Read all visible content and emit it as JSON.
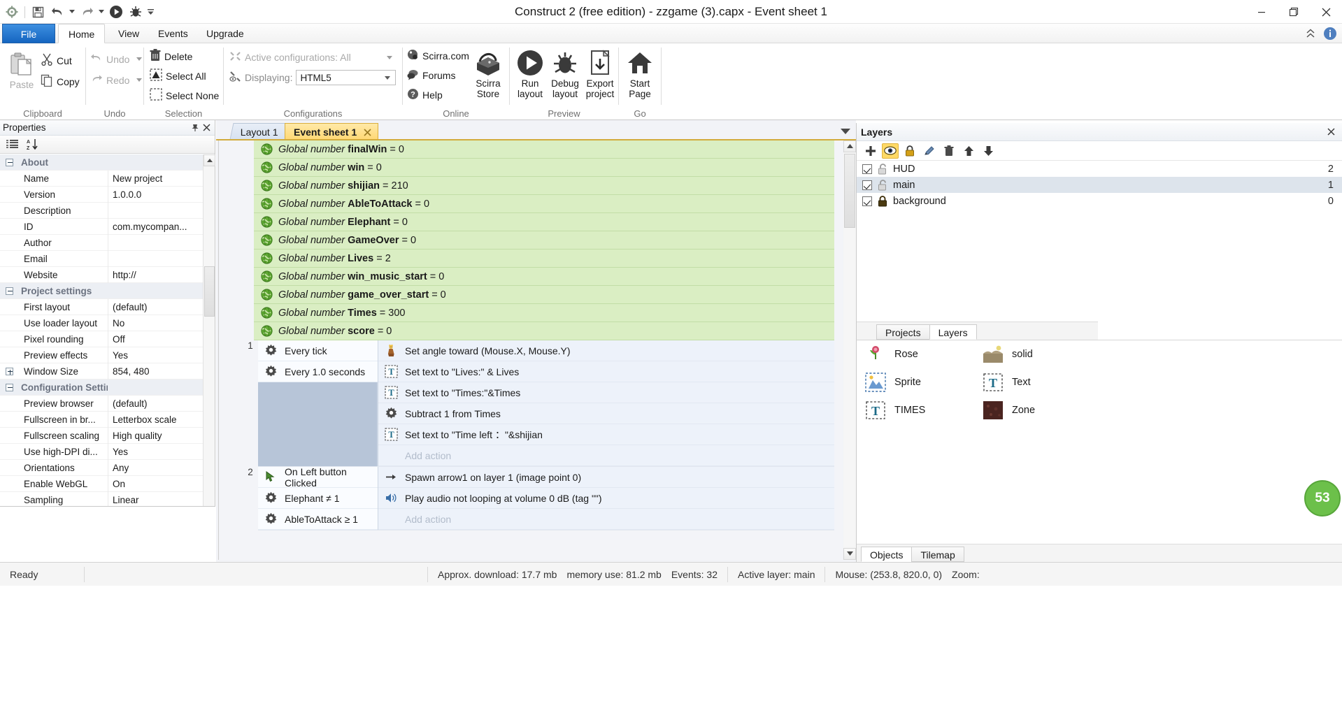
{
  "window": {
    "title": "Construct 2  (free edition) - zzgame (3).capx - Event sheet 1",
    "minimize_label": "Minimize",
    "maximize_label": "Restore",
    "close_label": "Close"
  },
  "quick_access": {
    "items": [
      {
        "name": "construct-logo-icon",
        "label": "Construct 2"
      },
      {
        "name": "save-icon",
        "label": "Save"
      },
      {
        "name": "undo-icon",
        "label": "Undo"
      },
      {
        "name": "undo-dropdown-icon",
        "label": "Undo history"
      },
      {
        "name": "redo-icon",
        "label": "Redo"
      },
      {
        "name": "redo-dropdown-icon",
        "label": "Redo history"
      },
      {
        "name": "run-icon",
        "label": "Run layout"
      },
      {
        "name": "debug-icon",
        "label": "Debug layout"
      },
      {
        "name": "customize-qat-icon",
        "label": "Customize Quick Access Toolbar"
      }
    ]
  },
  "ribbon": {
    "tabs": [
      {
        "label": "File",
        "active": false
      },
      {
        "label": "Home",
        "active": true
      },
      {
        "label": "View",
        "active": false
      },
      {
        "label": "Events",
        "active": false
      },
      {
        "label": "Upgrade",
        "active": false
      }
    ],
    "right_icons": [
      {
        "name": "ribbon-collapse-icon",
        "label": "Minimize the Ribbon"
      },
      {
        "name": "help-info-icon",
        "label": "Help"
      }
    ],
    "groups": [
      {
        "name": "clipboard",
        "label": "Clipboard",
        "items": [
          {
            "label": "Paste",
            "icon": "paste-icon",
            "disabled": true
          },
          {
            "label": "Cut",
            "icon": "cut-icon",
            "disabled": false
          },
          {
            "label": "Copy",
            "icon": "copy-icon",
            "disabled": false
          }
        ]
      },
      {
        "name": "undo",
        "label": "Undo",
        "items": [
          {
            "label": "Undo",
            "icon": "undo-icon",
            "disabled": true
          },
          {
            "label": "Redo",
            "icon": "redo-icon",
            "disabled": true
          }
        ]
      },
      {
        "name": "selection",
        "label": "Selection",
        "items": [
          {
            "label": "Delete",
            "icon": "delete-icon",
            "disabled": false
          },
          {
            "label": "Select All",
            "icon": "select-all-icon",
            "disabled": false
          },
          {
            "label": "Select None",
            "icon": "select-none-icon",
            "disabled": false
          }
        ]
      },
      {
        "name": "configurations",
        "label": "Configurations",
        "active_configurations_label": "Active configurations: All",
        "displaying_label": "Displaying:",
        "displaying_value": "HTML5"
      },
      {
        "name": "online",
        "label": "Online",
        "items": [
          {
            "label": "Scirra.com",
            "icon": "scirra-icon"
          },
          {
            "label": "Forums",
            "icon": "forums-icon"
          },
          {
            "label": "Help",
            "icon": "help-icon"
          }
        ],
        "store_label_line1": "Scirra",
        "store_label_line2": "Store",
        "store_icon": "treasure-chest-icon"
      },
      {
        "name": "preview",
        "label": "Preview",
        "items": [
          {
            "line1": "Run",
            "line2": "layout",
            "icon": "play-icon"
          },
          {
            "line1": "Debug",
            "line2": "layout",
            "icon": "bug-icon"
          },
          {
            "line1": "Export",
            "line2": "project",
            "icon": "export-icon"
          }
        ]
      },
      {
        "name": "go",
        "label": "Go",
        "items": [
          {
            "line1": "Start",
            "line2": "Page",
            "icon": "home-icon"
          }
        ]
      }
    ]
  },
  "properties": {
    "title": "Properties",
    "pin_label": "Auto hide",
    "close_label": "Close",
    "toolbar": [
      {
        "name": "categorized-icon",
        "label": "Categorized"
      },
      {
        "name": "alphabetical-sort-icon",
        "label": "Alphabetical"
      }
    ],
    "rows": [
      {
        "type": "category",
        "name": "About",
        "expanded": true
      },
      {
        "type": "prop",
        "name": "Name",
        "value": "New project"
      },
      {
        "type": "prop",
        "name": "Version",
        "value": "1.0.0.0"
      },
      {
        "type": "prop",
        "name": "Description",
        "value": ""
      },
      {
        "type": "prop",
        "name": "ID",
        "value": "com.mycompan..."
      },
      {
        "type": "prop",
        "name": "Author",
        "value": ""
      },
      {
        "type": "prop",
        "name": "Email",
        "value": ""
      },
      {
        "type": "prop",
        "name": "Website",
        "value": "http://"
      },
      {
        "type": "category",
        "name": "Project settings",
        "expanded": true
      },
      {
        "type": "prop",
        "name": "First layout",
        "value": "(default)"
      },
      {
        "type": "prop",
        "name": "Use loader layout",
        "value": "No"
      },
      {
        "type": "prop",
        "name": "Pixel rounding",
        "value": "Off"
      },
      {
        "type": "prop",
        "name": "Preview effects",
        "value": "Yes"
      },
      {
        "type": "subcategory",
        "name": "Window Size",
        "value": "854, 480",
        "expanded": false
      },
      {
        "type": "category",
        "name": "Configuration Settings",
        "expanded": true
      },
      {
        "type": "prop",
        "name": "Preview browser",
        "value": "(default)"
      },
      {
        "type": "prop",
        "name": "Fullscreen in br...",
        "value": "Letterbox scale"
      },
      {
        "type": "prop",
        "name": "Fullscreen scaling",
        "value": "High quality"
      },
      {
        "type": "prop",
        "name": "Use high-DPI di...",
        "value": "Yes"
      },
      {
        "type": "prop",
        "name": "Orientations",
        "value": "Any"
      },
      {
        "type": "prop",
        "name": "Enable WebGL",
        "value": "On"
      },
      {
        "type": "prop",
        "name": "Sampling",
        "value": "Linear"
      }
    ]
  },
  "document_tabs": [
    {
      "label": "Layout 1",
      "active": false,
      "closable": false
    },
    {
      "label": "Event sheet 1",
      "active": true,
      "closable": true
    }
  ],
  "event_sheet": {
    "global_variables": [
      {
        "keyword": "Global number",
        "name": "finalWin",
        "value": "0"
      },
      {
        "keyword": "Global number",
        "name": "win",
        "value": "0"
      },
      {
        "keyword": "Global number",
        "name": "shijian",
        "value": "210"
      },
      {
        "keyword": "Global number",
        "name": "AbleToAttack",
        "value": "0"
      },
      {
        "keyword": "Global number",
        "name": "Elephant",
        "value": "0"
      },
      {
        "keyword": "Global number",
        "name": "GameOver",
        "value": "0"
      },
      {
        "keyword": "Global number",
        "name": "Lives",
        "value": "2"
      },
      {
        "keyword": "Global number",
        "name": "win_music_start",
        "value": "0"
      },
      {
        "keyword": "Global number",
        "name": "game_over_start",
        "value": "0"
      },
      {
        "keyword": "Global number",
        "name": "Times",
        "value": "300"
      },
      {
        "keyword": "Global number",
        "name": "score",
        "value": "0"
      }
    ],
    "events": [
      {
        "number": "1",
        "conditions": [
          {
            "icon": "system-gear-icon",
            "text": "Every tick"
          },
          {
            "icon": "system-gear-icon",
            "text": "Every 1.0 seconds"
          }
        ],
        "actions": [
          {
            "icon": "player-sprite-icon",
            "text": "Set angle toward (Mouse.X, Mouse.Y)"
          },
          {
            "icon": "text-object-icon",
            "text": "Set text to \"Lives:\" & Lives"
          },
          {
            "icon": "text-object-icon",
            "text": "Set text to \"Times:\"&Times"
          },
          {
            "icon": "system-gear-icon",
            "text": "Subtract 1 from Times"
          },
          {
            "icon": "text-object-icon",
            "text": "Set text to \"Time left ：\"&shijian"
          }
        ],
        "add_action_label": "Add action"
      },
      {
        "number": "2",
        "conditions": [
          {
            "icon": "mouse-icon",
            "text": "On Left button Clicked"
          },
          {
            "icon": "system-gear-icon",
            "text": "Elephant ≠ 1"
          },
          {
            "icon": "system-gear-icon",
            "text": "AbleToAttack ≥ 1"
          }
        ],
        "actions": [
          {
            "icon": "spawn-icon",
            "text": "Spawn arrow1 on layer 1 (image point 0)"
          },
          {
            "icon": "audio-icon",
            "text": "Play audio not looping at volume 0 dB (tag \"\")"
          }
        ],
        "add_action_label": "Add action"
      }
    ]
  },
  "layers_panel": {
    "title": "Layers",
    "close_label": "Close",
    "toolbar": [
      {
        "name": "add-layer-icon",
        "label": "Add layer",
        "active": false
      },
      {
        "name": "eye-visibility-icon",
        "label": "Toggle visibility",
        "active": true
      },
      {
        "name": "lock-layer-icon",
        "label": "Lock layer",
        "active": false
      },
      {
        "name": "rename-layer-icon",
        "label": "Rename layer",
        "active": false
      },
      {
        "name": "delete-layer-icon",
        "label": "Delete layer",
        "active": false
      },
      {
        "name": "move-layer-up-icon",
        "label": "Move up",
        "active": false
      },
      {
        "name": "move-layer-down-icon",
        "label": "Move down",
        "active": false
      }
    ],
    "layers": [
      {
        "name": "HUD",
        "index": "2",
        "visible": true,
        "locked": false,
        "selected": false
      },
      {
        "name": "main",
        "index": "1",
        "visible": true,
        "locked": false,
        "selected": true
      },
      {
        "name": "background",
        "index": "0",
        "visible": true,
        "locked": true,
        "selected": false
      }
    ],
    "tabs": [
      {
        "label": "Projects",
        "active": false
      },
      {
        "label": "Layers",
        "active": true
      }
    ]
  },
  "object_bar": {
    "objects": [
      {
        "name": "Rose",
        "thumb": "rose-sprite-icon"
      },
      {
        "name": "solid",
        "thumb": "solid-sprite-icon"
      },
      {
        "name": "Sprite",
        "thumb": "sprite-icon"
      },
      {
        "name": "Text",
        "thumb": "text-object-icon"
      },
      {
        "name": "TIMES",
        "thumb": "text-object-icon"
      },
      {
        "name": "Zone",
        "thumb": "zone-tile-icon"
      }
    ],
    "tabs": [
      {
        "label": "Objects",
        "active": true
      },
      {
        "label": "Tilemap",
        "active": false
      }
    ],
    "badge_value": "53"
  },
  "status_bar": {
    "ready_label": "Ready",
    "download_label": "Approx. download: 17.7 mb",
    "memory_label": "memory use: 81.2 mb",
    "events_label": "Events: 32",
    "active_layer_label": "Active layer: main",
    "mouse_label": "Mouse: (253.8, 820.0, 0)",
    "zoom_label": "Zoom:"
  },
  "colors": {
    "accent_blue": "#1565c0",
    "tab_yellow": "#ffd873",
    "global_var_green": "#daeec3",
    "action_blue": "#edf2fa",
    "badge_green": "#6cc04a"
  }
}
